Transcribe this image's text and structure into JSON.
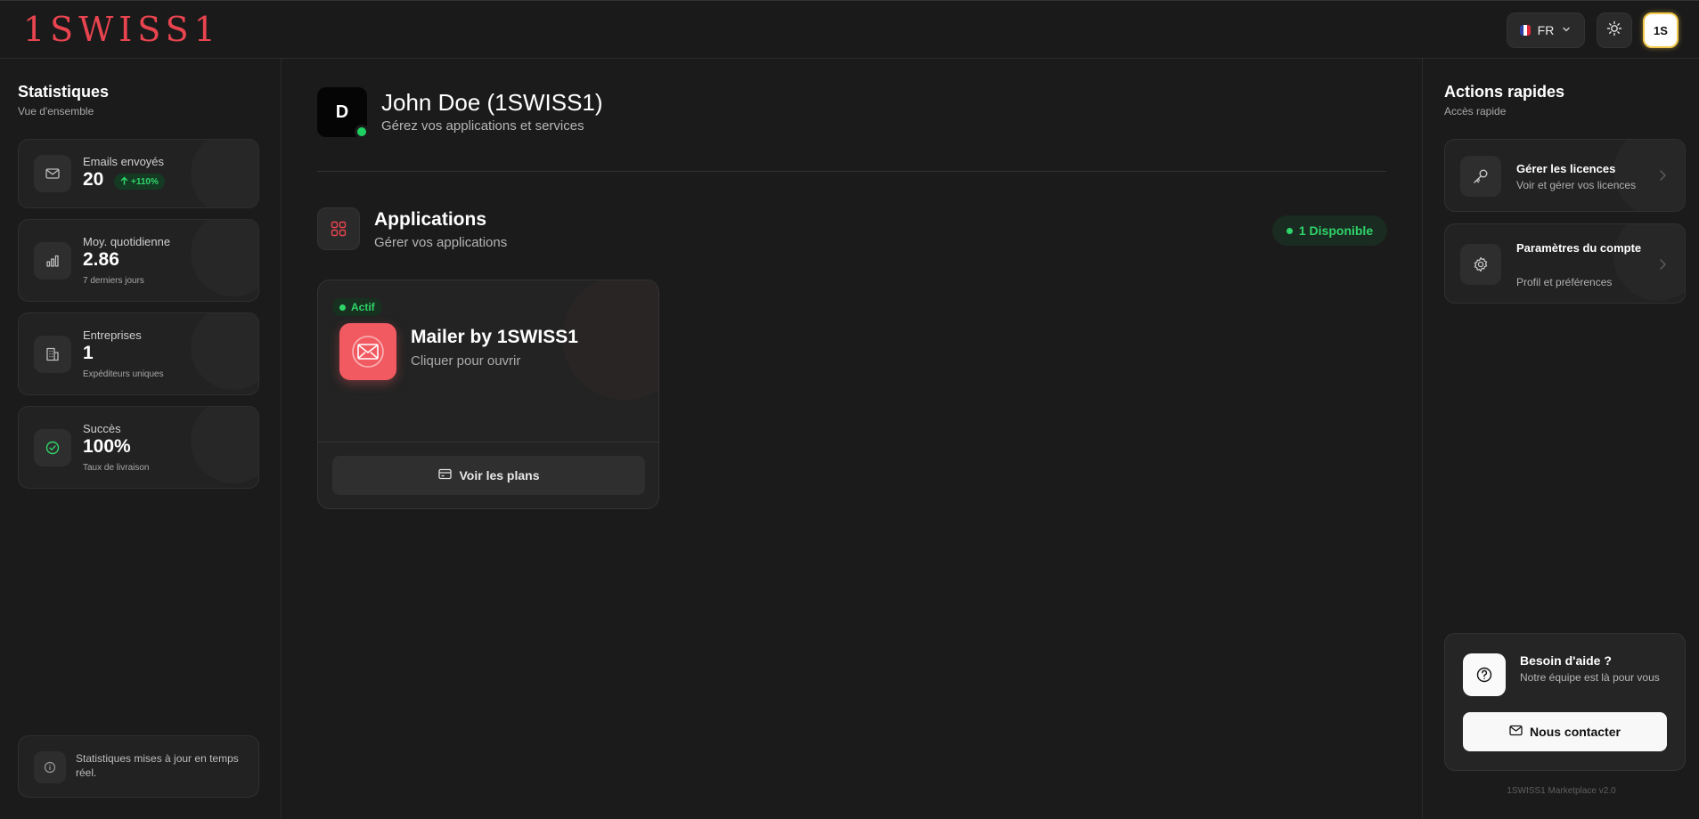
{
  "header": {
    "logo": "1SWISS1",
    "language": "FR",
    "avatar_initials": "1S"
  },
  "left_sidebar": {
    "title": "Statistiques",
    "subtitle": "Vue d'ensemble",
    "stats": [
      {
        "label": "Emails envoyés",
        "value": "20",
        "trend": "+110%",
        "icon": "mail-icon"
      },
      {
        "label": "Moy. quotidienne",
        "value": "2.86",
        "note": "7 derniers jours",
        "icon": "bar-chart-icon"
      },
      {
        "label": "Entreprises",
        "value": "1",
        "note": "Expéditeurs uniques",
        "icon": "building-icon"
      },
      {
        "label": "Succès",
        "value": "100%",
        "note": "Taux de livraison",
        "icon": "check-circle-icon"
      }
    ],
    "footer_text": "Statistiques mises à jour en temps réel."
  },
  "main": {
    "user": {
      "initial": "D",
      "name": "John Doe (1SWISS1)",
      "subtitle": "Gérez vos applications et services",
      "status": "online"
    },
    "apps_section": {
      "title": "Applications",
      "subtitle": "Gérer vos applications",
      "available_badge": "1 Disponible"
    },
    "app_card": {
      "status": "Actif",
      "name": "Mailer by 1SWISS1",
      "hint": "Cliquer pour ouvrir",
      "plans_button": "Voir les plans"
    }
  },
  "right_sidebar": {
    "title": "Actions rapides",
    "subtitle": "Accès rapide",
    "actions": [
      {
        "label": "Gérer les licences",
        "desc": "Voir et gérer vos licences",
        "icon": "key-icon"
      },
      {
        "label": "Paramètres du compte",
        "desc": "Profil et préférences",
        "icon": "gear-icon"
      }
    ],
    "help": {
      "title": "Besoin d'aide ?",
      "subtitle": "Notre équipe est là pour vous",
      "button": "Nous contacter"
    },
    "version": "1SWISS1 Marketplace v2.0"
  },
  "colors": {
    "brand": "#e8444f",
    "success": "#2fd46a",
    "background": "#1b1b1b",
    "card": "#222222",
    "avatar_ring": "#f3c94a"
  }
}
